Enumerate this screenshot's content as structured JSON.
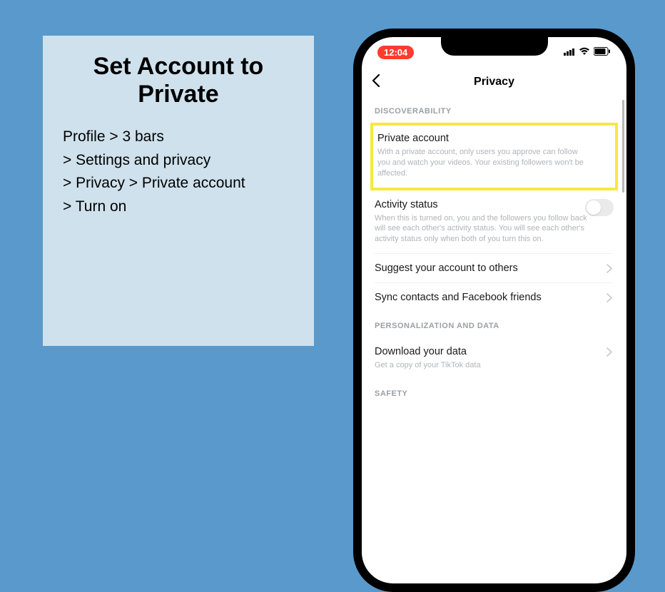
{
  "left": {
    "title_line1": "Set Account to",
    "title_line2": "Private",
    "step1": "Profile > 3 bars",
    "step2": "> Settings and privacy",
    "step3": "> Privacy > Private account",
    "step4": "> Turn on"
  },
  "phone": {
    "time": "12:04",
    "nav_title": "Privacy",
    "sections": {
      "discoverability": "DISCOVERABILITY",
      "personalization": "PERSONALIZATION AND DATA",
      "safety": "SAFETY"
    },
    "rows": {
      "private_account": {
        "title": "Private account",
        "sub": "With a private account, only users you approve can follow you and watch your videos. Your existing followers won't be affected."
      },
      "activity_status": {
        "title": "Activity status",
        "sub": "When this is turned on, you and the followers you follow back will see each other's activity status. You will see each other's activity status only when both of you turn this on."
      },
      "suggest": {
        "title": "Suggest your account to others"
      },
      "sync": {
        "title": "Sync contacts and Facebook friends"
      },
      "download": {
        "title": "Download your data",
        "sub": "Get a copy of your TikTok data"
      }
    }
  }
}
